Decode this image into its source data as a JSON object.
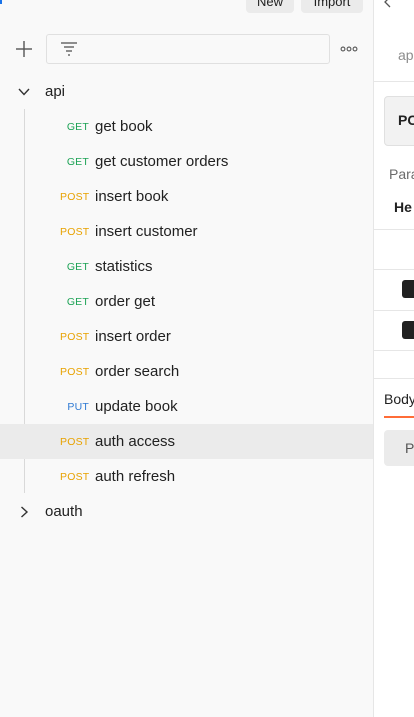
{
  "top_buttons": {
    "new_label": "New",
    "import_label": "Import"
  },
  "toolbar": {
    "filter_placeholder": "",
    "add_icon": "plus-icon",
    "filter_icon": "filter-lines-icon",
    "more_icon": "more-horizontal-icon"
  },
  "tree": {
    "api_folder": {
      "label": "api",
      "expanded": true
    },
    "requests": [
      {
        "method": "GET",
        "name": "get book"
      },
      {
        "method": "GET",
        "name": "get customer orders"
      },
      {
        "method": "POST",
        "name": "insert book"
      },
      {
        "method": "POST",
        "name": "insert customer"
      },
      {
        "method": "GET",
        "name": "statistics"
      },
      {
        "method": "GET",
        "name": "order get"
      },
      {
        "method": "POST",
        "name": "insert order"
      },
      {
        "method": "POST",
        "name": "order search"
      },
      {
        "method": "PUT",
        "name": "update book"
      },
      {
        "method": "POST",
        "name": "auth access",
        "selected": true
      },
      {
        "method": "POST",
        "name": "auth refresh"
      }
    ],
    "oauth_folder": {
      "label": "oauth",
      "expanded": false
    }
  },
  "right_pane": {
    "tab_fragment": "ap",
    "method_fragment": "PC",
    "params_fragment": "Para",
    "headers_fragment": "He",
    "body_fragment": "Body",
    "button_fragment": "P"
  },
  "colors": {
    "get": "#1da356",
    "post": "#e8a200",
    "put": "#2f7ad3",
    "accent": "#ff6c37",
    "selected_row": "#ebebeb"
  }
}
